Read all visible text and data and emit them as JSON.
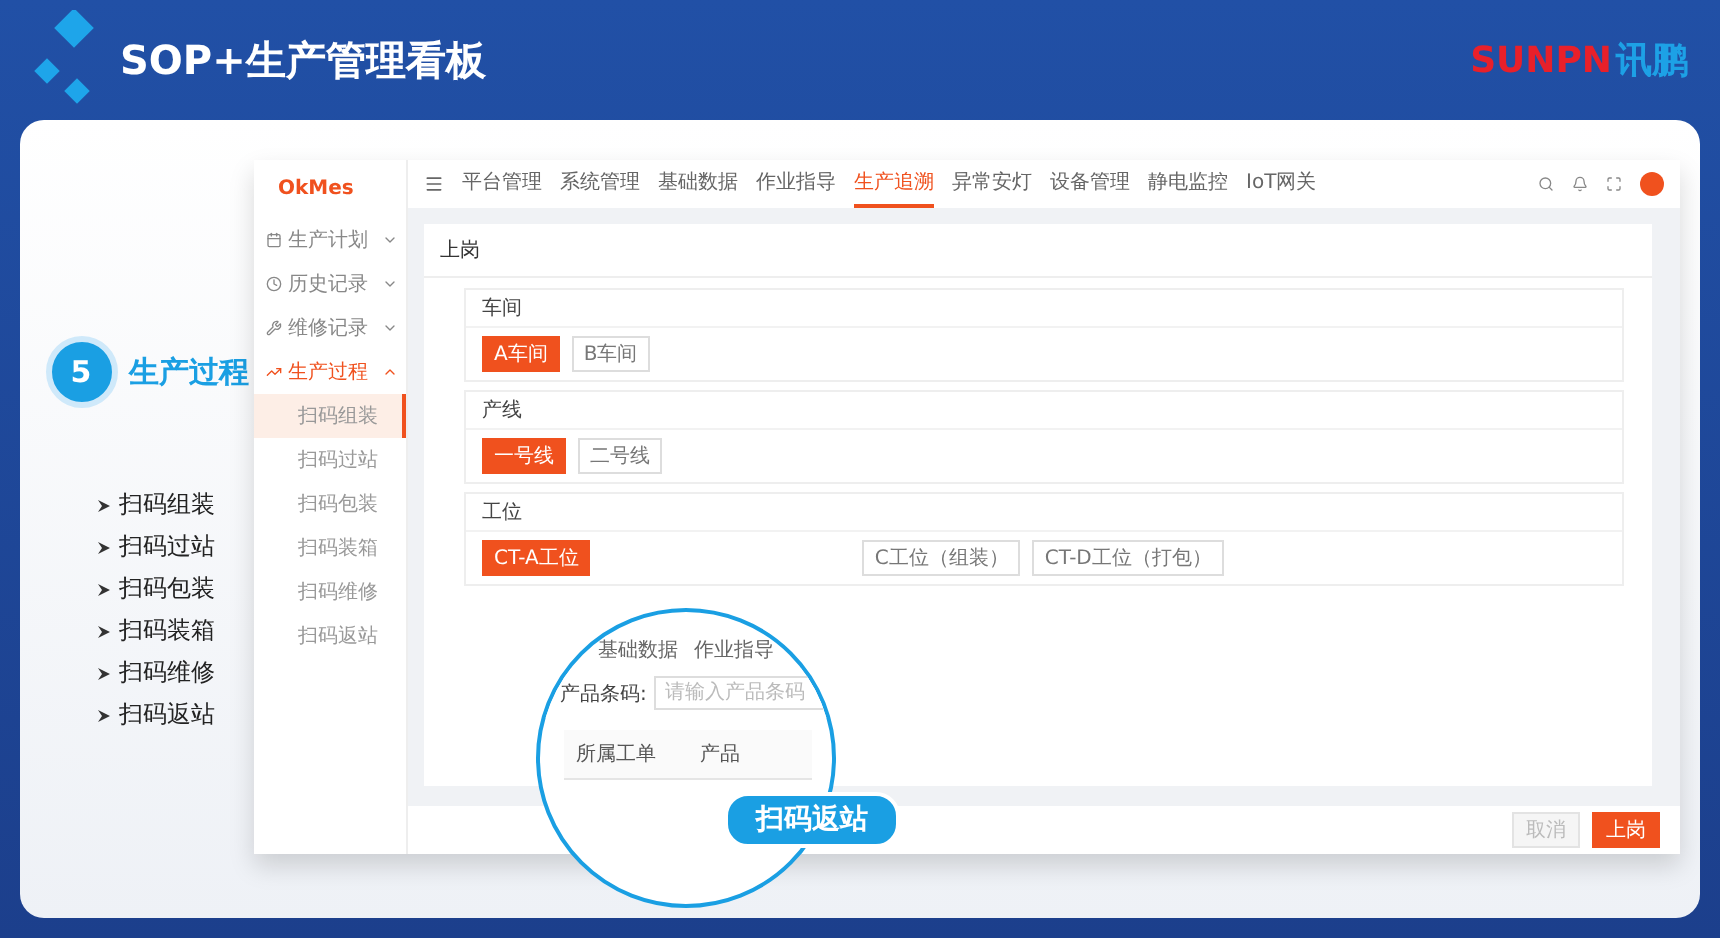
{
  "slide": {
    "title": "SOP+生产管理看板",
    "logo": {
      "latin": "SUNPN",
      "cjk": "讯鹏"
    }
  },
  "step": {
    "number": "5",
    "label": "生产过程"
  },
  "features": [
    "扫码组装",
    "扫码过站",
    "扫码包装",
    "扫码装箱",
    "扫码维修",
    "扫码返站"
  ],
  "app": {
    "brand": "OkMes",
    "nav": [
      {
        "label": "平台管理",
        "selected": false
      },
      {
        "label": "系统管理",
        "selected": false
      },
      {
        "label": "基础数据",
        "selected": false
      },
      {
        "label": "作业指导",
        "selected": false
      },
      {
        "label": "生产追溯",
        "selected": true
      },
      {
        "label": "异常安灯",
        "selected": false
      },
      {
        "label": "设备管理",
        "selected": false
      },
      {
        "label": "静电监控",
        "selected": false
      },
      {
        "label": "IoT网关",
        "selected": false
      }
    ],
    "sidebar": [
      {
        "label": "生产计划",
        "expanded": false
      },
      {
        "label": "历史记录",
        "expanded": false
      },
      {
        "label": "维修记录",
        "expanded": false
      },
      {
        "label": "生产过程",
        "expanded": true,
        "children": [
          {
            "label": "扫码组装",
            "selected": true
          },
          {
            "label": "扫码过站",
            "selected": false
          },
          {
            "label": "扫码包装",
            "selected": false
          },
          {
            "label": "扫码装箱",
            "selected": false
          },
          {
            "label": "扫码维修",
            "selected": false
          },
          {
            "label": "扫码返站",
            "selected": false
          }
        ]
      }
    ],
    "page_title": "上岗",
    "sections": [
      {
        "title": "车间",
        "options": [
          {
            "label": "A车间",
            "selected": true
          },
          {
            "label": "B车间",
            "selected": false
          }
        ]
      },
      {
        "title": "产线",
        "options": [
          {
            "label": "一号线",
            "selected": true
          },
          {
            "label": "二号线",
            "selected": false
          }
        ]
      },
      {
        "title": "工位",
        "options": [
          {
            "label": "CT-A工位",
            "selected": true
          },
          {
            "label": "C工位（组装）",
            "selected": false
          },
          {
            "label": "CT-D工位（打包）",
            "selected": false
          }
        ]
      }
    ],
    "actions": [
      {
        "label": "取消",
        "kind": "cancel"
      },
      {
        "label": "上岗",
        "kind": "primary"
      }
    ]
  },
  "magnifier": {
    "nav": [
      {
        "label": "基础数据",
        "selected": false
      },
      {
        "label": "作业指导",
        "selected": false
      }
    ],
    "field_label": "产品条码:",
    "placeholder": "请输入产品条码",
    "columns": [
      "所属工单",
      "产品"
    ],
    "caption": "扫码返站"
  }
}
